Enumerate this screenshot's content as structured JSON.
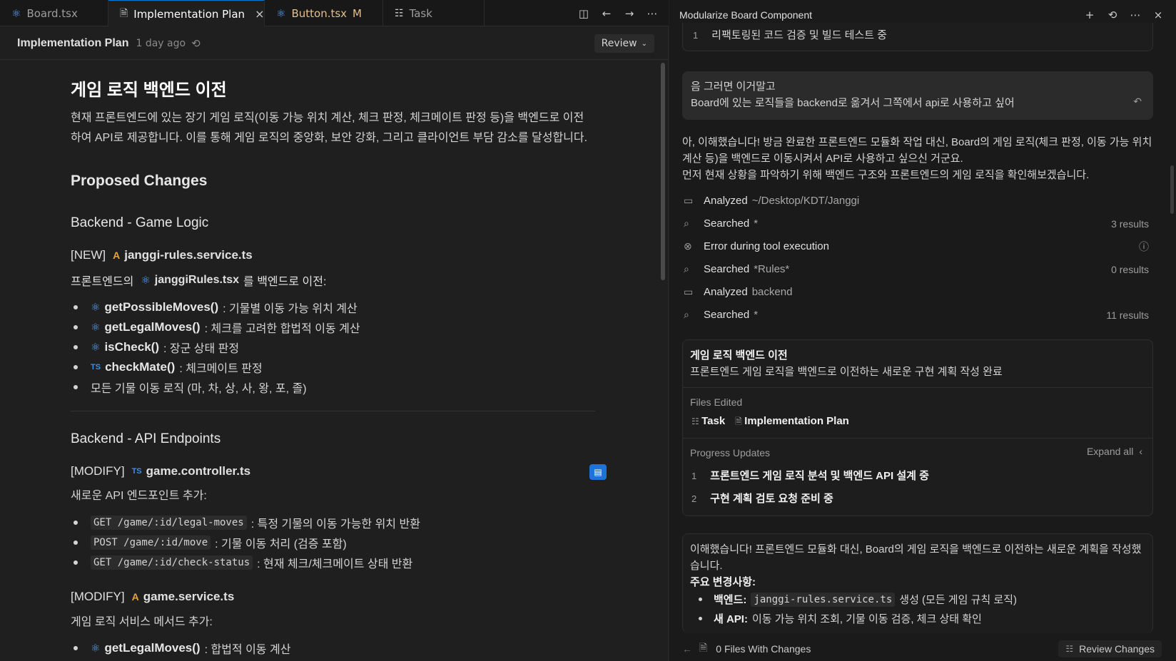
{
  "tabs": [
    {
      "label": "Board.tsx",
      "icon": "react-icon",
      "state": ""
    },
    {
      "label": "Implementation Plan",
      "icon": "file-icon",
      "state": "active"
    },
    {
      "label": "Button.tsx",
      "icon": "react-icon",
      "state": "M"
    },
    {
      "label": "Task",
      "icon": "checklist-icon",
      "state": ""
    }
  ],
  "doc": {
    "title": "Implementation Plan",
    "updated": "1 day ago",
    "review_label": "Review"
  },
  "content": {
    "h1": "게임 로직 백엔드 이전",
    "intro_line1": "현재 프론트엔드에 있는 장기 게임 로직(이동 가능 위치 계산, 체크 판정, 체크메이트 판정 등)을 백엔드로 이전",
    "intro_line2": "하여 API로 제공합니다. 이를 통해 게임 로직의 중앙화, 보안 강화, 그리고 클라이언트 부담 감소를 달성합니다.",
    "h2": "Proposed Changes",
    "section1": {
      "title": "Backend - Game Logic",
      "file_tag": "[NEW]",
      "file_name": "janggi-rules.service.ts",
      "desc_pre": "프론트엔드의",
      "desc_file": "janggiRules.tsx",
      "desc_post": "를 백엔드로 이전:",
      "bullets": [
        {
          "fn": "getPossibleMoves()",
          "text": ": 기물별 이동 가능 위치 계산"
        },
        {
          "fn": "getLegalMoves()",
          "text": ": 체크를 고려한 합법적 이동 계산"
        },
        {
          "fn": "isCheck()",
          "text": ": 장군 상태 판정"
        },
        {
          "fn": "checkMate()",
          "text": ": 체크메이트 판정"
        },
        {
          "fn": "",
          "text": "모든 기물 이동 로직 (마, 차, 상, 사, 왕, 포, 졸)"
        }
      ]
    },
    "section2": {
      "title": "Backend - API Endpoints",
      "file_tag": "[MODIFY]",
      "file_name": "game.controller.ts",
      "desc": "새로운 API 엔드포인트 추가:",
      "endpoints": [
        {
          "code": "GET /game/:id/legal-moves",
          "text": ": 특정 기물의 이동 가능한 위치 반환"
        },
        {
          "code": "POST /game/:id/move",
          "text": ": 기물 이동 처리 (검증 포함)"
        },
        {
          "code": "GET /game/:id/check-status",
          "text": ": 현재 체크/체크메이트 상태 반환"
        }
      ],
      "file2_tag": "[MODIFY]",
      "file2_name": "game.service.ts",
      "desc2": "게임 로직 서비스 메서드 추가:",
      "bullet2_fn": "getLegalMoves()",
      "bullet2_text": ": 합법적 이동 계산"
    }
  },
  "panel": {
    "title": "Modularize Board Component",
    "top_step_num": "1",
    "top_step_text": "리팩토링된 코드 검증 및 빌드 테스트 중",
    "user_line1": "음 그러면 이거말고",
    "user_line2": "Board에 있는 로직들을 backend로 옮겨서 그쪽에서 api로 사용하고 싶어",
    "reply_line1": "아, 이해했습니다! 방금 완료한 프론트엔드 모듈화 작업 대신, Board의 게임 로직(체크 판정, 이동 가능 위치",
    "reply_line2": "계산 등)을 백엔드로 이동시켜서 API로 사용하고 싶으신 거군요.",
    "reply_line3": "먼저 현재 상황을 파악하기 위해 백엔드 구조와 프론트엔드의 게임 로직을 확인해보겠습니다.",
    "steps": [
      {
        "verb": "Analyzed",
        "arg": "~/Desktop/KDT/Janggi",
        "result": ""
      },
      {
        "verb": "Searched",
        "arg": "*",
        "result": "3 results"
      },
      {
        "verb": "Error during tool execution",
        "arg": "",
        "result": ""
      },
      {
        "verb": "Searched",
        "arg": "*Rules*",
        "result": "0 results"
      },
      {
        "verb": "Analyzed",
        "arg": "backend",
        "result": ""
      },
      {
        "verb": "Searched",
        "arg": "*",
        "result": "11 results"
      }
    ],
    "task_card": {
      "title": "게임 로직 백엔드 이전",
      "subtitle": "프론트엔드 게임 로직을 백엔드로 이전하는 새로운 구현 계획 작성 완료",
      "files_edited_label": "Files Edited",
      "file1": "Task",
      "file2": "Implementation Plan",
      "progress_label": "Progress Updates",
      "expand_label": "Expand all",
      "updates": [
        {
          "num": "1",
          "text": "프론트엔드 게임 로직 분석 및 백엔드 API 설계 중"
        },
        {
          "num": "2",
          "text": "구현 계획 검토 요청 준비 중"
        }
      ]
    },
    "final": {
      "line1": "이해했습니다! 프론트엔드 모듈화 대신, Board의 게임 로직을 백엔드로 이전하는 새로운 계획을 작성했",
      "line2": "습니다.",
      "heading": "주요 변경사항:",
      "b1_label": "백엔드:",
      "b1_code": "janggi-rules.service.ts",
      "b1_text": "생성 (모든 게임 규칙 로직)",
      "b2_label": "새 API:",
      "b2_text": "이동 가능 위치 조회, 기물 이동 검증, 체크 상태 확인"
    },
    "footer_files": "0 Files With Changes",
    "footer_review": "Review Changes"
  }
}
